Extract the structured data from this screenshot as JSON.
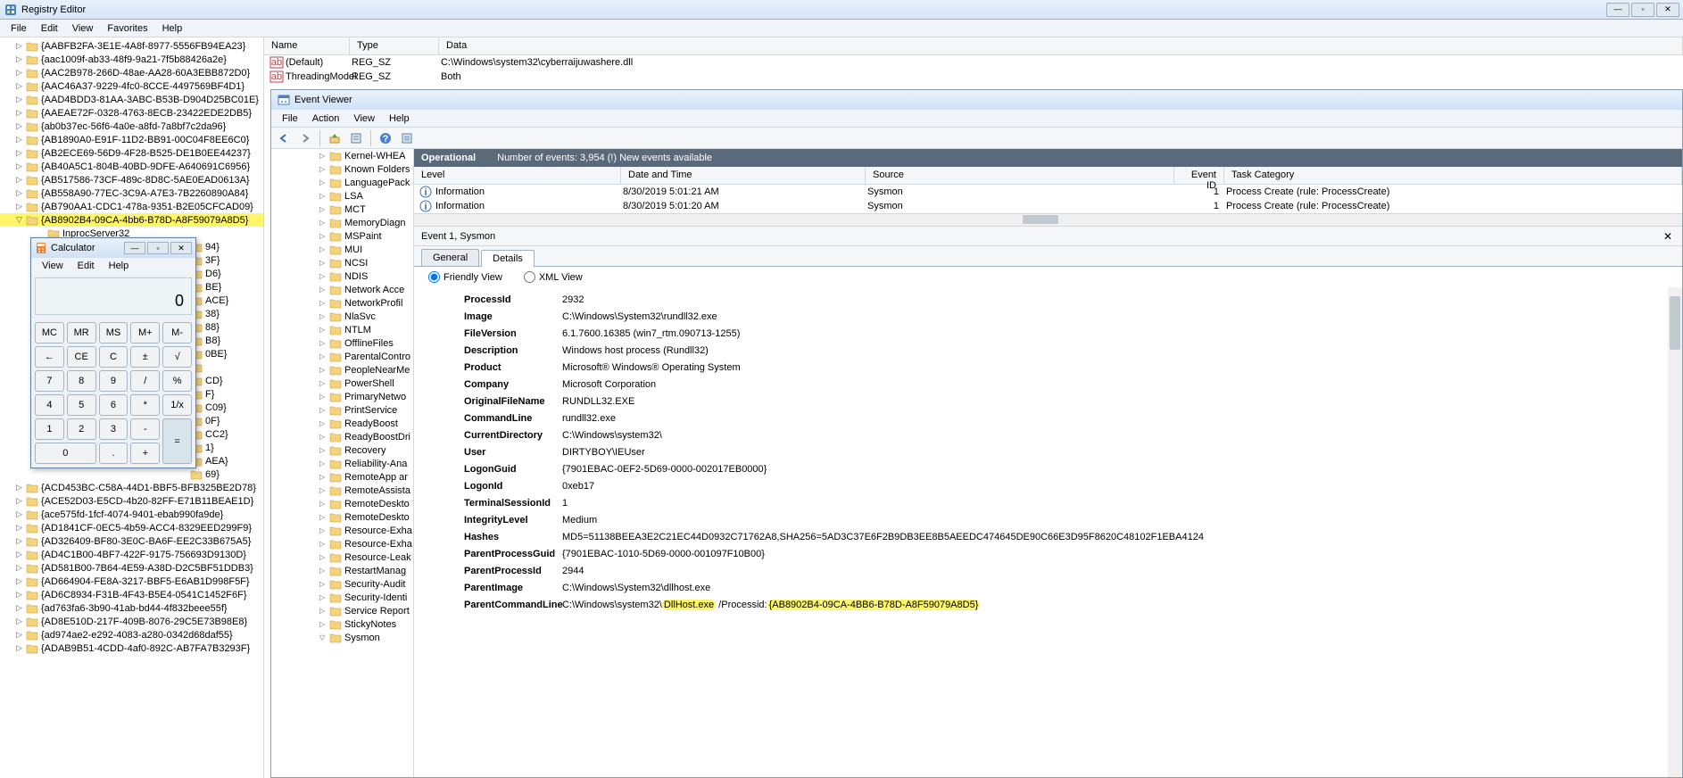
{
  "regedit": {
    "title": "Registry Editor",
    "menu": [
      "File",
      "Edit",
      "View",
      "Favorites",
      "Help"
    ],
    "tree_items": [
      "{AABFB2FA-3E1E-4A8f-8977-5556FB94EA23}",
      "{aac1009f-ab33-48f9-9a21-7f5b88426a2e}",
      "{AAC2B978-266D-48ae-AA28-60A3EBB872D0}",
      "{AAC46A37-9229-4fc0-8CCE-4497569BF4D1}",
      "{AAD4BDD3-81AA-3ABC-B53B-D904D25BC01E}",
      "{AAEAE72F-0328-4763-8ECB-23422EDE2DB5}",
      "{ab0b37ec-56f6-4a0e-a8fd-7a8bf7c2da96}",
      "{AB1890A0-E91F-11D2-BB91-00C04F8EE6C0}",
      "{AB2ECE69-56D9-4F28-B525-DE1B0EE44237}",
      "{AB40A5C1-804B-40BD-9DFE-A640691C6956}",
      "{AB517586-73CF-489c-8D8C-5AE0EAD0613A}",
      "{AB558A90-77EC-3C9A-A7E3-7B2260890A84}",
      "{AB790AA1-CDC1-478a-9351-B2E05CFCAD09}"
    ],
    "tree_selected": "{AB8902B4-09CA-4bb6-B78D-A8F59079A8D5}",
    "tree_child": "InprocServer32",
    "tree_tail_partials": [
      "94}",
      "3F}",
      "D6}",
      "BE}",
      "ACE}",
      "38}",
      "88}",
      "B8}",
      "0BE}",
      "",
      "CD}",
      "F}",
      "C09}",
      "0F}",
      "CC2}",
      "1}",
      "AEA}",
      "69}"
    ],
    "tree_after": [
      "{ACD453BC-C58A-44D1-BBF5-BFB325BE2D78}",
      "{ACE52D03-E5CD-4b20-82FF-E71B11BEAE1D}",
      "{ace575fd-1fcf-4074-9401-ebab990fa9de}",
      "{AD1841CF-0EC5-4b59-ACC4-8329EED299F9}",
      "{AD326409-BF80-3E0C-BA6F-EE2C33B675A5}",
      "{AD4C1B00-4BF7-422F-9175-756693D9130D}",
      "{AD581B00-7B64-4E59-A38D-D2C5BF51DDB3}",
      "{AD664904-FE8A-3217-BBF5-E6AB1D998F5F}",
      "{AD6C8934-F31B-4F43-B5E4-0541C1452F6F}",
      "{ad763fa6-3b90-41ab-bd44-4f832beee55f}",
      "{AD8E510D-217F-409B-8076-29C5E73B98E8}",
      "{ad974ae2-e292-4083-a280-0342d68daf55}",
      "{ADAB9B51-4CDD-4af0-892C-AB7FA7B3293F}"
    ],
    "values": {
      "hdr": [
        "Name",
        "Type",
        "Data"
      ],
      "rows": [
        {
          "name": "(Default)",
          "type": "REG_SZ",
          "data": "C:\\Windows\\system32\\cyberraijuwashere.dll"
        },
        {
          "name": "ThreadingModel",
          "type": "REG_SZ",
          "data": "Both"
        }
      ]
    }
  },
  "ev": {
    "title": "Event Viewer",
    "menu": [
      "File",
      "Action",
      "View",
      "Help"
    ],
    "tree": [
      "Kernel-WHEA",
      "Known Folders",
      "LanguagePack",
      "LSA",
      "MCT",
      "MemoryDiagn",
      "MSPaint",
      "MUI",
      "NCSI",
      "NDIS",
      "Network Acce",
      "NetworkProfil",
      "NlaSvc",
      "NTLM",
      "OfflineFiles",
      "ParentalContro",
      "PeopleNearMe",
      "PowerShell",
      "PrimaryNetwo",
      "PrintService",
      "ReadyBoost",
      "ReadyBoostDri",
      "Recovery",
      "Reliability-Ana",
      "RemoteApp ar",
      "RemoteAssista",
      "RemoteDeskto",
      "RemoteDeskto",
      "Resource-Exha",
      "Resource-Exha",
      "Resource-Leak",
      "RestartManag",
      "Security-Audit",
      "Security-Identi",
      "Service Report",
      "StickyNotes"
    ],
    "tree_last": "Sysmon",
    "ops": {
      "label": "Operational",
      "count_text": "Number of events: 3,954 (!) New events available"
    },
    "evthdr": [
      "Level",
      "Date and Time",
      "Source",
      "Event ID",
      "Task Category"
    ],
    "evtrows": [
      {
        "level": "Information",
        "dt": "8/30/2019 5:01:21 AM",
        "src": "Sysmon",
        "id": "1",
        "task": "Process Create (rule: ProcessCreate)"
      },
      {
        "level": "Information",
        "dt": "8/30/2019 5:01:20 AM",
        "src": "Sysmon",
        "id": "1",
        "task": "Process Create (rule: ProcessCreate)"
      }
    ],
    "detail_title": "Event 1, Sysmon",
    "tabs": [
      "General",
      "Details"
    ],
    "views": [
      "Friendly View",
      "XML View"
    ],
    "props": [
      {
        "k": "ProcessId",
        "v": "2932"
      },
      {
        "k": "Image",
        "v": "C:\\Windows\\System32\\rundll32.exe"
      },
      {
        "k": "FileVersion",
        "v": "6.1.7600.16385 (win7_rtm.090713-1255)"
      },
      {
        "k": "Description",
        "v": "Windows host process (Rundll32)"
      },
      {
        "k": "Product",
        "v": "Microsoft® Windows® Operating System"
      },
      {
        "k": "Company",
        "v": "Microsoft Corporation"
      },
      {
        "k": "OriginalFileName",
        "v": "RUNDLL32.EXE"
      },
      {
        "k": "CommandLine",
        "v": "rundll32.exe"
      },
      {
        "k": "CurrentDirectory",
        "v": "C:\\Windows\\system32\\"
      },
      {
        "k": "User",
        "v": "DIRTYBOY\\IEUser"
      },
      {
        "k": "LogonGuid",
        "v": "{7901EBAC-0EF2-5D69-0000-002017EB0000}"
      },
      {
        "k": "LogonId",
        "v": "0xeb17"
      },
      {
        "k": "TerminalSessionId",
        "v": "1"
      },
      {
        "k": "IntegrityLevel",
        "v": "Medium"
      },
      {
        "k": "Hashes",
        "v": "MD5=51138BEEA3E2C21EC44D0932C71762A8,SHA256=5AD3C37E6F2B9DB3EE8B5AEEDC474645DE90C66E3D95F8620C48102F1EBA4124"
      },
      {
        "k": "ParentProcessGuid",
        "v": "{7901EBAC-1010-5D69-0000-001097F10B00}"
      },
      {
        "k": "ParentProcessId",
        "v": "2944"
      },
      {
        "k": "ParentImage",
        "v": "C:\\Windows\\System32\\dllhost.exe"
      }
    ],
    "pcl": {
      "k": "ParentCommandLine",
      "pre": "C:\\Windows\\system32\\",
      "h1": "DllHost.exe",
      "mid": " /Processid:",
      "h2": "{AB8902B4-09CA-4BB6-B78D-A8F59079A8D5}"
    }
  },
  "calc": {
    "title": "Calculator",
    "menu": [
      "View",
      "Edit",
      "Help"
    ],
    "display": "0",
    "keys": [
      [
        "MC",
        "MR",
        "MS",
        "M+",
        "M-"
      ],
      [
        "←",
        "CE",
        "C",
        "±",
        "√"
      ],
      [
        "7",
        "8",
        "9",
        "/",
        "%"
      ],
      [
        "4",
        "5",
        "6",
        "*",
        "1/x"
      ],
      [
        "1",
        "2",
        "3",
        "-",
        "="
      ],
      [
        "0",
        ".",
        "+"
      ]
    ]
  }
}
